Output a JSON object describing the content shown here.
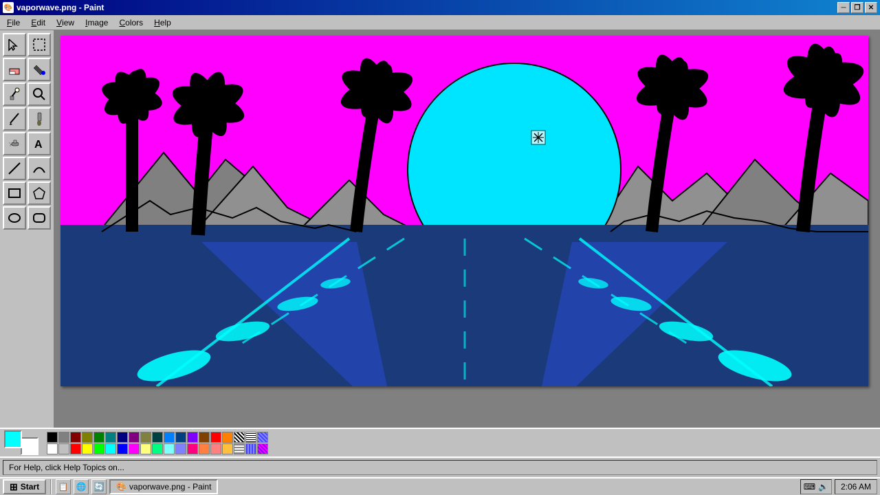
{
  "window": {
    "title": "vaporwave.png - Paint",
    "icon": "🖼"
  },
  "titlebar": {
    "minimize_label": "─",
    "restore_label": "❐",
    "close_label": "✕"
  },
  "menu": {
    "items": [
      "File",
      "Edit",
      "View",
      "Image",
      "Colors",
      "Help"
    ]
  },
  "tools": [
    {
      "id": "select-free",
      "symbol": "⬚",
      "title": "Free-form select"
    },
    {
      "id": "select-rect",
      "symbol": "⬜",
      "title": "Select"
    },
    {
      "id": "eraser",
      "symbol": "◻",
      "title": "Eraser"
    },
    {
      "id": "fill",
      "symbol": "⌫",
      "title": "Fill with color"
    },
    {
      "id": "eyedropper",
      "symbol": "💉",
      "title": "Pick color"
    },
    {
      "id": "magnifier",
      "symbol": "🔍",
      "title": "Magnifier"
    },
    {
      "id": "pencil",
      "symbol": "✏",
      "title": "Pencil"
    },
    {
      "id": "brush",
      "symbol": "🖌",
      "title": "Brush"
    },
    {
      "id": "airbrush",
      "symbol": "💨",
      "title": "Airbrush"
    },
    {
      "id": "text",
      "symbol": "A",
      "title": "Text"
    },
    {
      "id": "line",
      "symbol": "╱",
      "title": "Line"
    },
    {
      "id": "curve",
      "symbol": "∿",
      "title": "Curve"
    },
    {
      "id": "rect-outline",
      "symbol": "▭",
      "title": "Rectangle"
    },
    {
      "id": "poly",
      "symbol": "⬡",
      "title": "Polygon"
    },
    {
      "id": "ellipse",
      "symbol": "⬭",
      "title": "Ellipse"
    },
    {
      "id": "rect-filled",
      "symbol": "▬",
      "title": "Rounded Rectangle"
    }
  ],
  "colors": {
    "foreground": "#00ffff",
    "background": "#ffffff",
    "palette": [
      [
        "#000000",
        "#808080",
        "#800000",
        "#808000",
        "#008000",
        "#008080",
        "#000080",
        "#800080",
        "#808040",
        "#004040",
        "#0080ff",
        "#004080",
        "#8000ff",
        "#804000",
        "#ff0000",
        "#ff8000"
      ],
      [
        "#ffffff",
        "#c0c0c0",
        "#ff0000",
        "#ffff00",
        "#00ff00",
        "#00ffff",
        "#0000ff",
        "#ff00ff",
        "#ffff80",
        "#00ff80",
        "#80ffff",
        "#8080ff",
        "#ff0080",
        "#ff8040",
        "#ff8080",
        "#ffc040"
      ]
    ]
  },
  "status": {
    "text": "For Help, click Help Topics on..."
  },
  "taskbar": {
    "start_label": "Start",
    "app_label": "vaporwave.png - Paint",
    "time": "2:06 AM"
  }
}
